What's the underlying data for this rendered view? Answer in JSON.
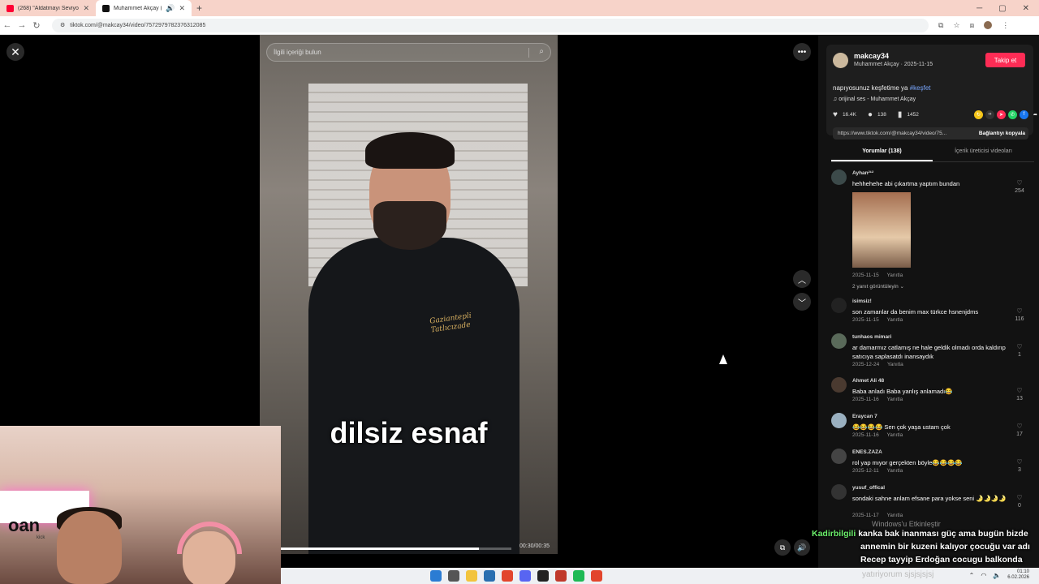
{
  "browser": {
    "tabs": [
      {
        "title": "(268) \"Aldatmayı Seviyorum\" |",
        "active": false,
        "favicon_color": "#ff0033"
      },
      {
        "title": "Muhammet Akçay (@makc",
        "active": true,
        "favicon_color": "#111111"
      }
    ],
    "new_tab_glyph": "+",
    "url": "tiktok.com/@makcay34/video/7572979782376312085"
  },
  "viewer": {
    "search_placeholder": "İlgili içeriği bulun",
    "subtitle": "dilsiz esnaf",
    "jacket_text_1": "Gaziantepli",
    "jacket_text_2": "Tatlıcızade",
    "time": "00:30/00:35",
    "progress": 0.86
  },
  "post": {
    "username": "makcay34",
    "display_and_date": "Muhammet Akçay · 2025-11-15",
    "follow_label": "Takip et",
    "caption": "napıyosunuz keşfetime ya ",
    "hashtag": "#keşfet",
    "sound": "orijinal ses - Muhammet Akçay",
    "likes": "16.4K",
    "comments": "138",
    "saves": "1452",
    "link": "https://www.tiktok.com/@makcay34/video/75...",
    "copy_label": "Bağlantıyı kopyala",
    "tab_comments": "Yorumlar (138)",
    "tab_videos": "İçerik üreticisi videoları"
  },
  "comments": [
    {
      "user": "Ayhan²¹²",
      "text": "hehhehehe abi çıkartma yaptım bundan",
      "meta": "2025-11-15 Yanıtla",
      "likes": "254",
      "replies": "2 yanıt görüntüleyin ⌄"
    },
    {
      "user": "isimsiz!",
      "text": "son zamanlar da benim max türkce hsnenjdms",
      "meta": "2025-11-15 Yanıtla",
      "likes": "116"
    },
    {
      "user": "tunhaos mimari",
      "text": "ar damarmız catlamış ne hale geldik olmadı orda kaldırıp satıcıya saplasatdı inansaydık",
      "meta": "2025-12-24 Yanıtla",
      "likes": "1"
    },
    {
      "user": "Ahmet Ali 48",
      "text": "Baba anladı Baba yanlış anlamadı😂",
      "meta": "2025-11-16 Yanıtla",
      "likes": "13"
    },
    {
      "user": "Eraycan 7",
      "text": "😂😂😂😂 Sen çok yaşa ustam çok",
      "meta": "2025-11-16 Yanıtla",
      "likes": "17"
    },
    {
      "user": "ENES.ZAZA",
      "text": "rol yap mıyor gerçekten böyle😂😂😂😂",
      "meta": "2025-12-11 Yanıtla",
      "likes": "3"
    },
    {
      "user": "yusuf_offical",
      "text": "sondaki sahne anlam efsane para yokse seni 🌛🌛🌛🌛",
      "meta": "2025-11-17 Yanıtla",
      "likes": "0"
    }
  ],
  "webcam": {
    "brand": "oan",
    "brand_sub": "kick"
  },
  "chat": {
    "nick": "Kadirbilgili",
    "line1": "kanka bak inanması güç ama bugün bizde",
    "line2": "annemin bir kuzeni kalıyor çocuğu var adı",
    "line3": "Recep tayyip Erdoğan cocugu balkonda"
  },
  "overlay_faded": "Windows'u Etkinleştir",
  "taskbar": {
    "faded_text": "yatıriyorum sjsjsjsjsj",
    "time": "01:10",
    "date": "6.02.2026"
  }
}
